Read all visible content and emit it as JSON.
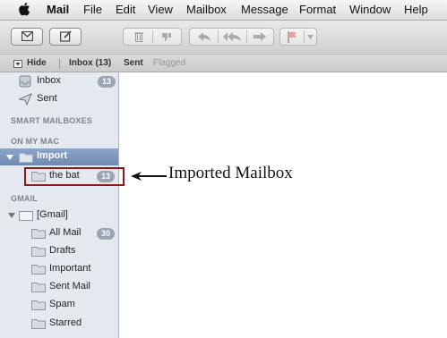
{
  "menubar": {
    "items": [
      "Mail",
      "File",
      "Edit",
      "View",
      "Mailbox",
      "Message",
      "Format",
      "Window",
      "Help"
    ]
  },
  "favorites": {
    "hide_label": "Hide",
    "inbox_label": "Inbox (13)",
    "sent_label": "Sent",
    "flagged_label": "Flagged"
  },
  "sidebar": {
    "inbox": {
      "label": "Inbox",
      "count": "13"
    },
    "sent": {
      "label": "Sent"
    },
    "smart_mailboxes_header": "SMART MAILBOXES",
    "on_my_mac_header": "ON MY MAC",
    "import": {
      "label": "Import"
    },
    "the_bat": {
      "label": "the bat",
      "count": "13"
    },
    "gmail_header": "GMAIL",
    "gmail": {
      "label": "[Gmail]"
    },
    "all_mail": {
      "label": "All Mail",
      "count": "30"
    },
    "drafts": {
      "label": "Drafts"
    },
    "important": {
      "label": "Important"
    },
    "sent_mail": {
      "label": "Sent Mail"
    },
    "spam": {
      "label": "Spam"
    },
    "starred": {
      "label": "Starred"
    }
  },
  "annotation": {
    "text": "Imported Mailbox"
  },
  "colors": {
    "selection": "#7a93bb",
    "highlight_border": "#8b1a1a",
    "badge": "#9ba5b3",
    "sidebar_bg": "#e4e9ef"
  }
}
